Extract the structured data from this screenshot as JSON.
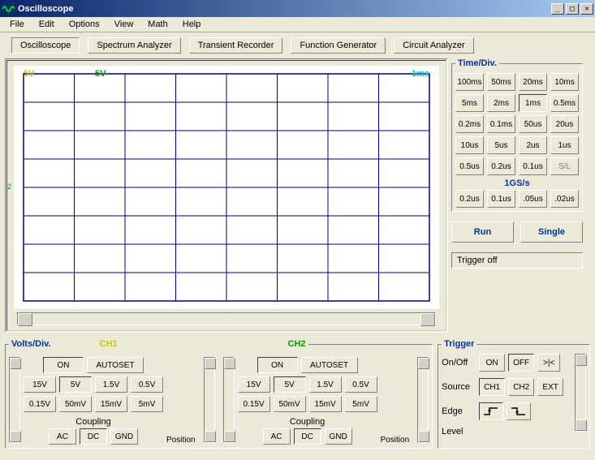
{
  "window": {
    "title": "Oscilloscope"
  },
  "menu": {
    "items": [
      "File",
      "Edit",
      "Options",
      "View",
      "Math",
      "Help"
    ]
  },
  "tabs": {
    "items": [
      "Oscilloscope",
      "Spectrum Analyzer",
      "Transient Recorder",
      "Function Generator",
      "Circuit Analyzer"
    ],
    "active": 0
  },
  "scope": {
    "ch1_v": "5V",
    "ch2_v": "5V",
    "time": "1ms",
    "axis_marker": "2"
  },
  "timediv": {
    "legend": "Time/Div.",
    "rows": [
      [
        "100ms",
        "50ms",
        "20ms",
        "10ms"
      ],
      [
        "5ms",
        "2ms",
        "1ms",
        "0.5ms"
      ],
      [
        "0.2ms",
        "0.1ms",
        "50us",
        "20us"
      ],
      [
        "10us",
        "5us",
        "2us",
        "1us"
      ],
      [
        "0.5us",
        "0.2us",
        "0.1us",
        "S/L"
      ]
    ],
    "gs_label": "1GS/s",
    "gs_row": [
      "0.2us",
      "0.1us",
      ".05us",
      ".02us"
    ],
    "active": "1ms",
    "disabled": "S/L"
  },
  "runrow": {
    "run": "Run",
    "single": "Single"
  },
  "status": {
    "text": "Trigger off"
  },
  "volts": {
    "legend": "Volts/Div.",
    "ch1_label": "CH1",
    "ch2_label": "CH2",
    "on": "ON",
    "autoset": "AUTOSET",
    "row1": [
      "15V",
      "5V",
      "1.5V",
      "0.5V"
    ],
    "row2": [
      "0.15V",
      "50mV",
      "15mV",
      "5mV"
    ],
    "coupling_label": "Coupling",
    "coupling": [
      "AC",
      "DC",
      "GND"
    ],
    "coupling_active": "DC",
    "position_label": "Position",
    "active": "5V"
  },
  "trigger": {
    "legend": "Trigger",
    "onoff_label": "On/Off",
    "on": "ON",
    "off": "OFF",
    "reset": ">|<",
    "source_label": "Source",
    "sources": [
      "CH1",
      "CH2",
      "EXT"
    ],
    "source_active": "CH1",
    "edge_label": "Edge",
    "level_label": "Level",
    "off_active": true
  }
}
